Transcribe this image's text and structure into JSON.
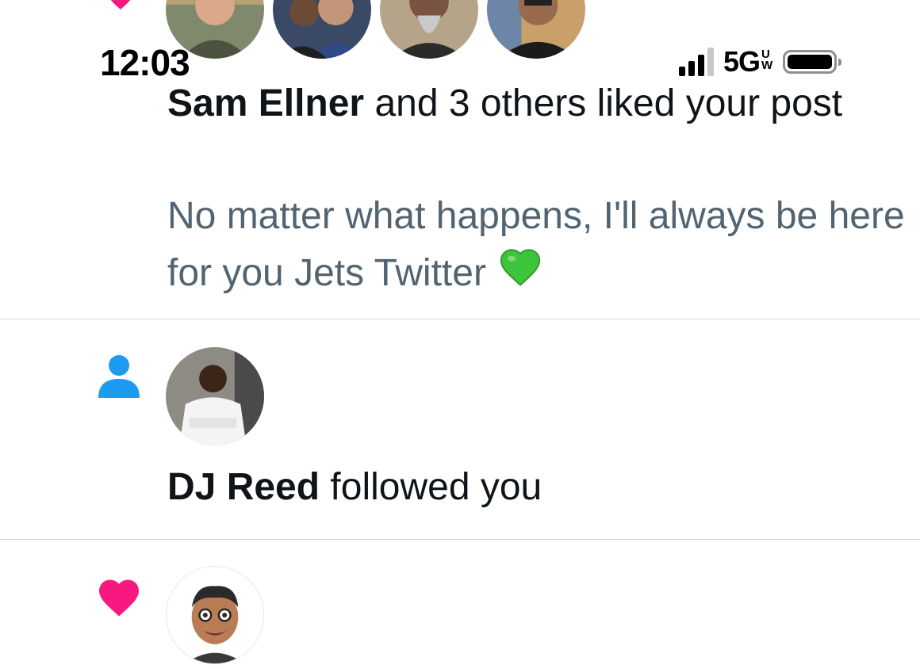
{
  "status_bar": {
    "time": "12:03",
    "network": "5G",
    "network_sup_top": "U",
    "network_sup_bottom": "W",
    "signal_bars_filled": 3,
    "battery_level": 1.0
  },
  "colors": {
    "like_heart": "#f91880",
    "follow_person": "#1d9bf0",
    "preview_text": "#536471",
    "primary_text": "#0f1419",
    "divider": "#cfd9de"
  },
  "notifications": [
    {
      "type": "like",
      "icon": "heart-icon",
      "actor": "Sam Ellner",
      "action": " and 3 others liked your post",
      "preview": "No matter what happens, I'll always be here for you Jets Twitter",
      "preview_emoji": "💚"
    },
    {
      "type": "follow",
      "icon": "person-icon",
      "actor": "DJ Reed",
      "action": " followed you"
    },
    {
      "type": "like",
      "icon": "heart-icon"
    }
  ]
}
